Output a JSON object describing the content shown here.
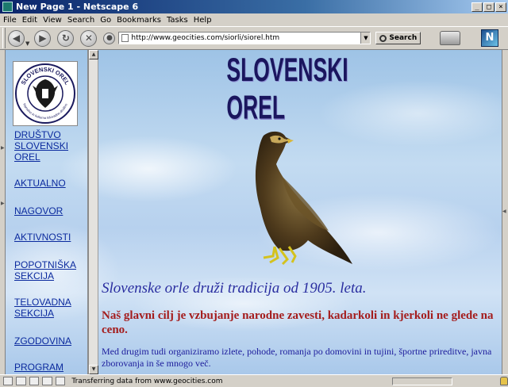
{
  "window": {
    "title": "New Page 1 - Netscape 6"
  },
  "menu": [
    "File",
    "Edit",
    "View",
    "Search",
    "Go",
    "Bookmarks",
    "Tasks",
    "Help"
  ],
  "toolbar": {
    "url": "http://www.geocities.com/siorli/siorel.htm",
    "search_label": "Search"
  },
  "sidebar": {
    "logo": {
      "name": "SLOVENSKI OREL",
      "subtitle": "Narodno in kulturno telovadno društvo"
    },
    "links": [
      "DRUŠTVO SLOVENSKI OREL",
      "AKTUALNO",
      "NAGOVOR",
      "AKTIVNOSTI",
      "POPOTNIŠKA SEKCIJA",
      "TELOVADNA SEKCIJA",
      "ZGODOVINA",
      "PROGRAM"
    ]
  },
  "main": {
    "site_title": "SLOVENSKI OREL",
    "tagline": "Slovenske orle druži tradicija od 1905. leta.",
    "goal": "Naš glavni cilj je vzbujanje narodne zavesti, kadarkoli in kjerkoli ne glede na ceno.",
    "activities": "Med drugim tudi organiziramo izlete, pohode, romanja po domovini in tujini, športne prireditve, javna zborovanja in še mnogo več."
  },
  "status": {
    "text": "Transferring data from www.geocities.com",
    "progress": 0.0
  },
  "colors": {
    "nav_link": "#0b2a9e",
    "tagline": "#2a2ea0",
    "goal": "#a41c1c",
    "titlebar": "#0a246a"
  }
}
